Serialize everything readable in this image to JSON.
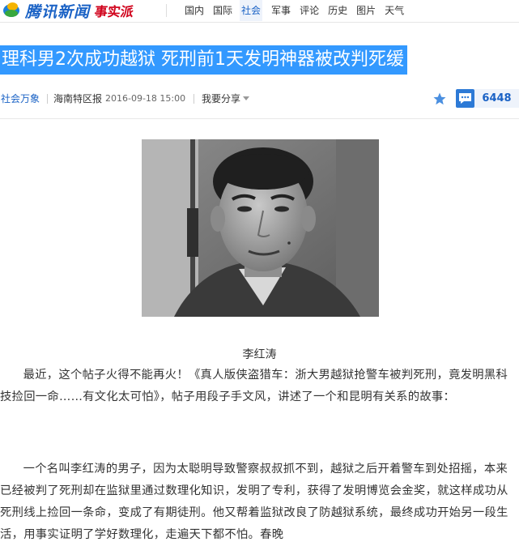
{
  "brand": {
    "logo_text": "腾讯新闻",
    "sub_logo": "事实派"
  },
  "nav": {
    "items": [
      "国内",
      "国际",
      "社会",
      "军事",
      "评论",
      "历史",
      "图片",
      "天气"
    ],
    "active_index": 2
  },
  "article": {
    "headline": "理科男2次成功越狱 死刑前1天发明神器被改判死缓",
    "category": "社会万象",
    "source": "海南特区报",
    "time": "2016-09-18 15:00",
    "share_label": "我要分享",
    "comment_count": "6448",
    "image_caption": "李红涛",
    "paragraphs": [
      "最近，这个帖子火得不能再火！《真人版侠盗猎车：浙大男越狱抢警车被判死刑，竟发明黑科技捡回一命……有文化太可怕》，帖子用段子手文风，讲述了一个和昆明有关系的故事：",
      "一个名叫李红涛的男子，因为太聪明导致警察叔叔抓不到，越狱之后开着警车到处招摇，本来已经被判了死刑却在监狱里通过数理化知识，发明了专利，获得了发明博览会金奖，就这样成功从死刑线上捡回一条命，变成了有期徒刑。他又帮着监狱改良了防越狱系统，最终成功开始另一段生活，用事实证明了学好数理化，走遍天下都不怕。春晚"
    ]
  },
  "colors": {
    "accent": "#1a62c5",
    "headline_bg": "#3399ff",
    "star": "#4a8fe0"
  },
  "icons": [
    "logo-icon",
    "star-icon",
    "comment-icon",
    "caret-down-icon"
  ]
}
